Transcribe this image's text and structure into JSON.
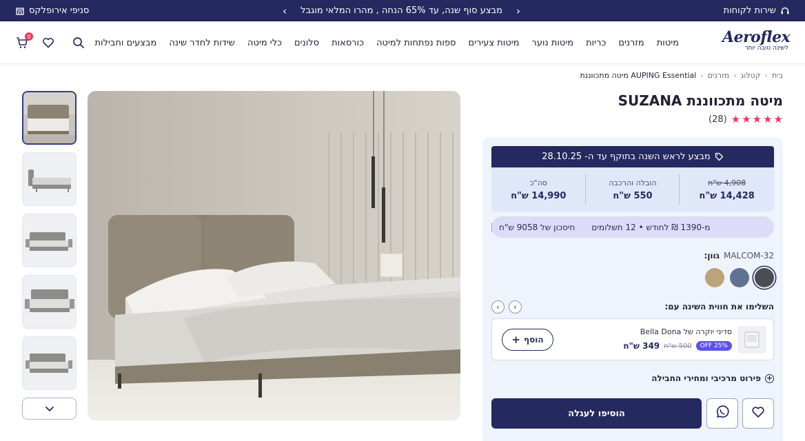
{
  "topbar": {
    "stores_label": "סניפי אירופלקס",
    "promo_text": "מבצע סוף שנה, עד 65% הנחה , מהרו המלאי מוגבל",
    "service_label": "שירות לקוחות"
  },
  "brand": {
    "logo_text": "Aeroflex",
    "tagline": "לשינה טובה יותר"
  },
  "nav": {
    "items": [
      "מיטות",
      "מזרנים",
      "כריות",
      "מיטות נוער",
      "מיטות צעירים",
      "ספות נפתחות למיטה",
      "כורסאות",
      "סלונים",
      "כלי מיטה",
      "שידות לחדר שינה",
      "מבצעים וחבילות"
    ]
  },
  "header": {
    "cart_count": "0"
  },
  "breadcrumb": {
    "items": [
      "בית",
      "קטלוג",
      "מזרנים",
      "מיטה מתכווננת AUPING Essential"
    ]
  },
  "product": {
    "title": "מיטה מתכווננת SUZANA",
    "rating_count": "(28)",
    "stars": 5
  },
  "deal": {
    "text": "מבצע לראש השנה בתוקף עד ה- 28.10.25"
  },
  "prices": {
    "old_price": "4,908 ש\"ח",
    "price": "14,428 ש\"ח",
    "delivery_label": "הובלה והרכבה",
    "delivery_price": "550 ש\"ח",
    "total_label": "סה\"כ",
    "total_price": "14,990 ש\"ח"
  },
  "savings": {
    "saving_text": "חיסכון של 9058 ש\"ח",
    "installments_text": "מ-1390 ₪ לחודש • 12 תשלומים"
  },
  "color": {
    "label": "גוון:",
    "value": "MALCOM-32",
    "swatches": [
      "#4b4d52",
      "#5f7391",
      "#bba37a"
    ]
  },
  "complete": {
    "title": "השלימו את חווית השינה עם:",
    "addon_name": "סדיני יוקרה של  Bella Dona",
    "addon_price": "349 ש\"ח",
    "addon_old_price": "500 ש\"ח",
    "addon_discount": "25% OFF",
    "addon_button": "הוסף"
  },
  "breakdown": {
    "label": "פירוט מרכיבי ומחירי החבילה"
  },
  "actions": {
    "add_to_cart": "הוסיפו לעגלה"
  }
}
